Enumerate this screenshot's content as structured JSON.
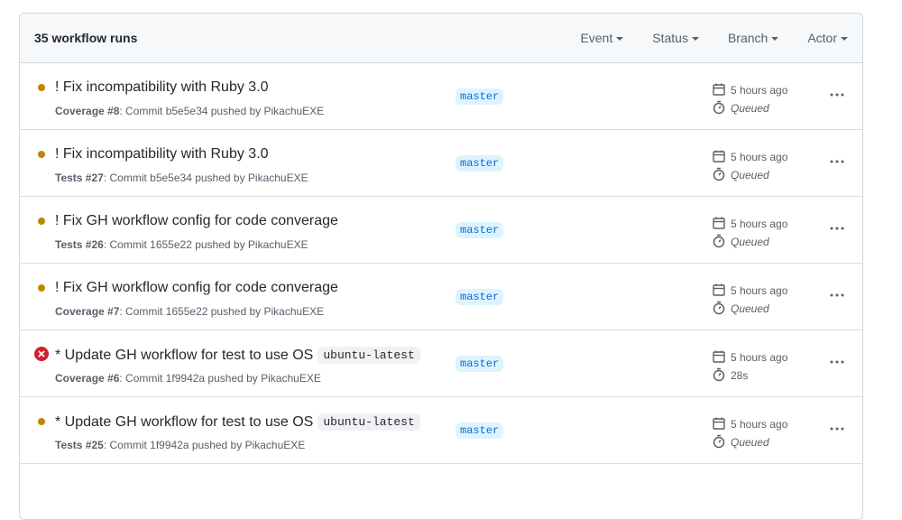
{
  "header": {
    "count_text": "35 workflow runs",
    "filters": [
      "Event",
      "Status",
      "Branch",
      "Actor"
    ]
  },
  "colors": {
    "queued_dot": "#bf8700",
    "failure": "#cf222e",
    "branch_bg": "#ddf4ff",
    "branch_text": "#0969da"
  },
  "runs": [
    {
      "status": "queued",
      "title": "! Fix incompatibility with Ruby 3.0",
      "code": "",
      "workflow_run": "Coverage #8",
      "commit_text": ": Commit b5e5e34 pushed by PikachuEXE",
      "branch": "master",
      "time": "5 hours ago",
      "duration": "Queued"
    },
    {
      "status": "queued",
      "title": "! Fix incompatibility with Ruby 3.0",
      "code": "",
      "workflow_run": "Tests #27",
      "commit_text": ": Commit b5e5e34 pushed by PikachuEXE",
      "branch": "master",
      "time": "5 hours ago",
      "duration": "Queued"
    },
    {
      "status": "queued",
      "title": "! Fix GH workflow config for code converage",
      "code": "",
      "workflow_run": "Tests #26",
      "commit_text": ": Commit 1655e22 pushed by PikachuEXE",
      "branch": "master",
      "time": "5 hours ago",
      "duration": "Queued"
    },
    {
      "status": "queued",
      "title": "! Fix GH workflow config for code converage",
      "code": "",
      "workflow_run": "Coverage #7",
      "commit_text": ": Commit 1655e22 pushed by PikachuEXE",
      "branch": "master",
      "time": "5 hours ago",
      "duration": "Queued"
    },
    {
      "status": "failure",
      "title": "* Update GH workflow for test to use OS",
      "code": "ubuntu-latest",
      "workflow_run": "Coverage #6",
      "commit_text": ": Commit 1f9942a pushed by PikachuEXE",
      "branch": "master",
      "time": "5 hours ago",
      "duration": "28s"
    },
    {
      "status": "queued",
      "title": "* Update GH workflow for test to use OS",
      "code": "ubuntu-latest",
      "workflow_run": "Tests #25",
      "commit_text": ": Commit 1f9942a pushed by PikachuEXE",
      "branch": "master",
      "time": "5 hours ago",
      "duration": "Queued"
    }
  ]
}
